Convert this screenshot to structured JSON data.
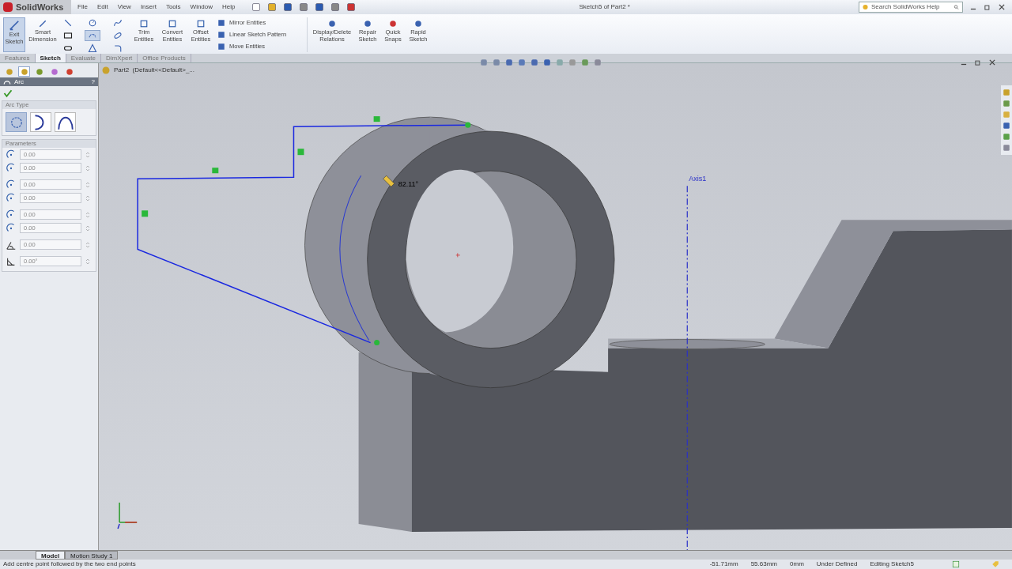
{
  "app": {
    "logo": "SolidWorks",
    "menu": [
      "File",
      "Edit",
      "View",
      "Insert",
      "Tools",
      "Window",
      "Help"
    ],
    "title": "Sketch5 of Part2 *",
    "search": {
      "placeholder": "Search SolidWorks Help"
    }
  },
  "ribbon": {
    "exit": {
      "label": "Exit Sketch",
      "selected": true
    },
    "smart": {
      "label": "Smart Dimension"
    },
    "sketch_tools": [
      {
        "kind": "line",
        "selected": false
      },
      {
        "kind": "circle",
        "selected": false
      },
      {
        "kind": "spline",
        "selected": false
      },
      {
        "kind": "rect",
        "selected": false
      },
      {
        "kind": "arc",
        "selected": true
      },
      {
        "kind": "ellipse",
        "selected": false
      },
      {
        "kind": "slot",
        "selected": false
      },
      {
        "kind": "polygon",
        "selected": false
      },
      {
        "kind": "fillet",
        "selected": false
      }
    ],
    "large": [
      {
        "label": "Trim Entities"
      },
      {
        "label": "Convert Entities"
      },
      {
        "label": "Offset Entities"
      }
    ],
    "small": [
      "Mirror Entities",
      "Linear Sketch Pattern",
      "Move Entities"
    ],
    "right": [
      {
        "label": "Display/Delete Relations"
      },
      {
        "label": "Repair Sketch"
      },
      {
        "label": "Quick Snaps"
      },
      {
        "label": "Rapid Sketch"
      }
    ]
  },
  "command_tabs": [
    {
      "label": "Features",
      "selected": false
    },
    {
      "label": "Sketch",
      "selected": true
    },
    {
      "label": "Evaluate",
      "selected": false
    },
    {
      "label": "DimXpert",
      "selected": false
    },
    {
      "label": "Office Products",
      "selected": false
    }
  ],
  "manager_tabs": [
    {
      "selected": false
    },
    {
      "selected": true
    },
    {
      "selected": false
    },
    {
      "selected": false
    },
    {
      "selected": false
    }
  ],
  "property_manager": {
    "title": "Arc",
    "help": "?",
    "arc_type": {
      "title": "Arc Type",
      "types": [
        {
          "selected": true
        },
        {
          "selected": false
        },
        {
          "selected": false
        }
      ]
    },
    "parameters": {
      "title": "Parameters",
      "fields": [
        {
          "value": "0.00"
        },
        {
          "value": "0.00"
        },
        {
          "value": "0.00"
        },
        {
          "value": "0.00"
        },
        {
          "value": "0.00"
        },
        {
          "value": "0.00"
        },
        {
          "value": "0.00"
        },
        {
          "value": "0.00°"
        }
      ]
    }
  },
  "tree": {
    "label": "Part2  (Default<<Default>_..."
  },
  "viewport": {
    "axis_label": "Axis1",
    "angle": "82.11°"
  },
  "bottom_tabs": [
    {
      "label": "Model",
      "selected": true
    },
    {
      "label": "Motion Study 1",
      "selected": false
    }
  ],
  "status_bar": {
    "message": "Add centre point followed by the two end points",
    "items": [
      "-51.71mm",
      "55.63mm",
      "0mm",
      "Under Defined",
      "Editing Sketch5"
    ]
  }
}
